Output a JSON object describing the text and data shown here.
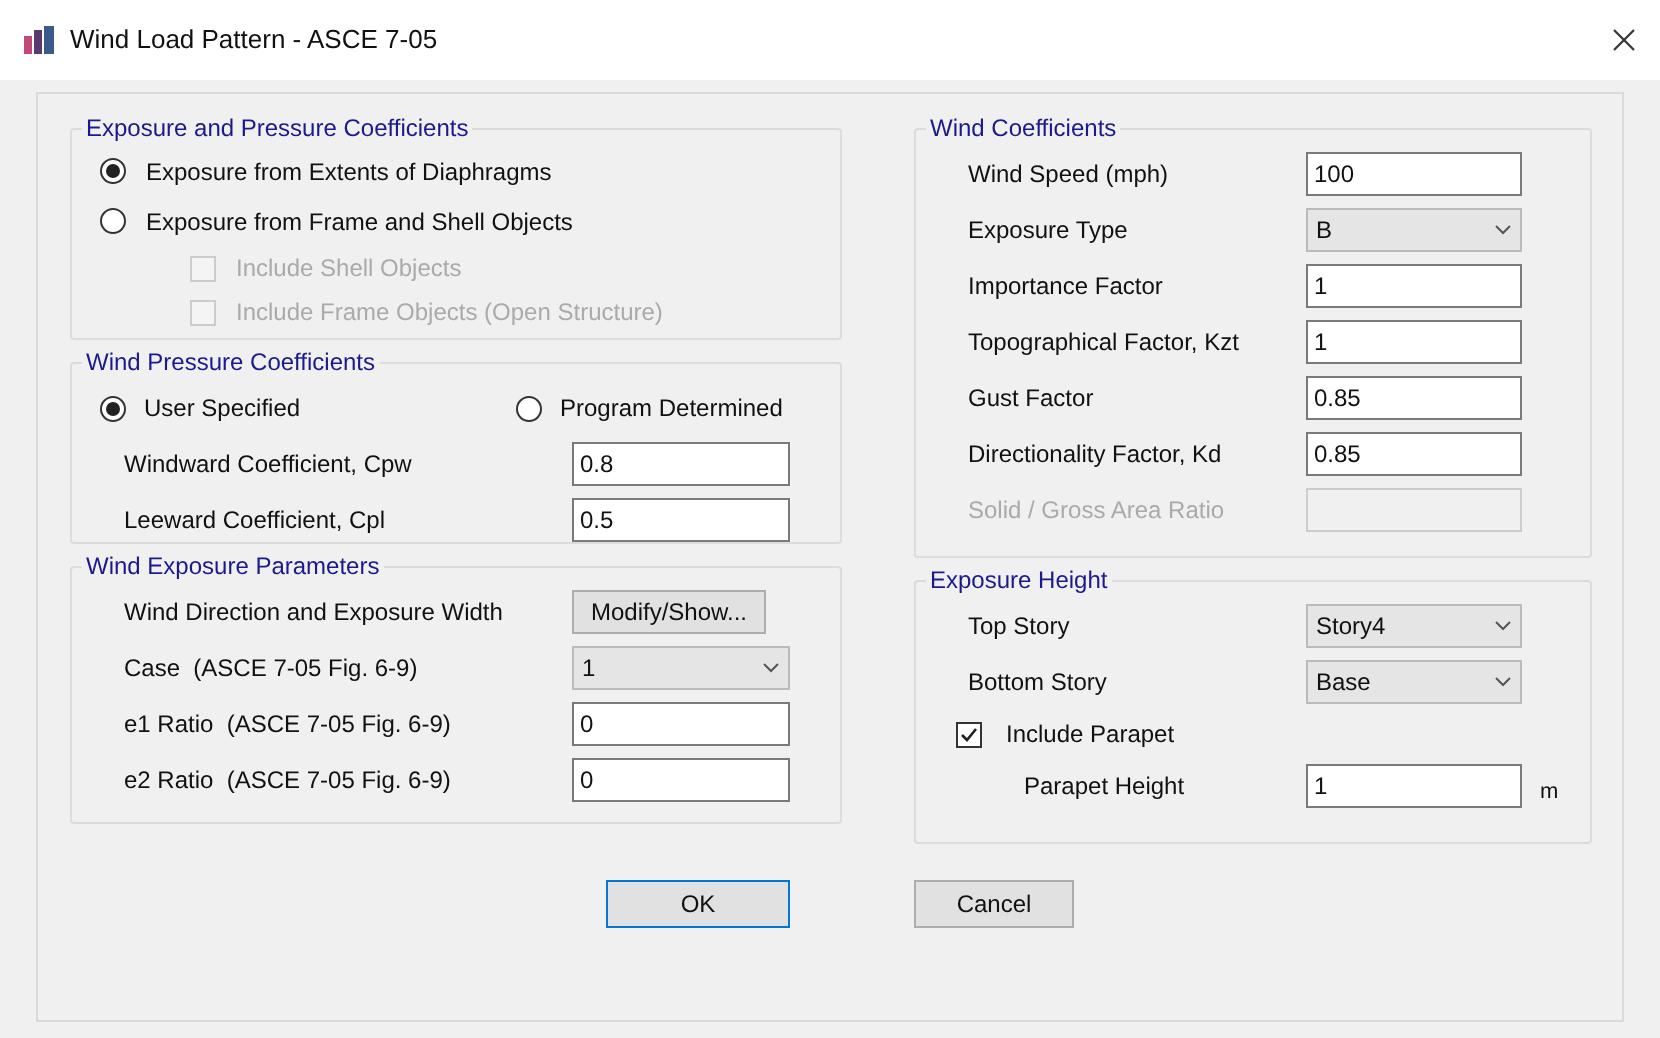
{
  "window": {
    "title": "Wind Load Pattern - ASCE 7-05"
  },
  "left_groups": [
    {
      "title": "Exposure and Pressure Coefficients",
      "rows": [
        {
          "kind": "radio",
          "label": "Exposure from Extents of Diaphragms",
          "selected": true,
          "children": []
        },
        {
          "kind": "radio",
          "label": "Exposure from Frame and Shell Objects",
          "selected": false,
          "children": [
            {
              "label": "Include Shell Objects",
              "checked": false,
              "disabled": true
            },
            {
              "label": "Include Frame Objects (Open Structure)",
              "checked": false,
              "disabled": true
            }
          ]
        }
      ]
    },
    {
      "title": "Wind Pressure Coefficients",
      "rows": [
        {
          "kind": "radio_pair",
          "options": [
            {
              "label": "User Specified",
              "selected": true
            },
            {
              "label": "Program Determined",
              "selected": false
            }
          ]
        },
        {
          "kind": "field",
          "label": "Windward Coefficient, Cpw",
          "value": "0.8",
          "disabled": false
        },
        {
          "kind": "field",
          "label": "Leeward Coefficient, Cpl",
          "value": "0.5",
          "disabled": false
        }
      ]
    },
    {
      "title": "Wind Exposure Parameters",
      "rows": [
        {
          "kind": "button",
          "label": "Wind Direction and Exposure Width",
          "button": "Modify/Show..."
        },
        {
          "kind": "dropdown",
          "label": "Case  (ASCE 7-05 Fig. 6-9)",
          "value": "1"
        },
        {
          "kind": "field",
          "label": "e1 Ratio  (ASCE 7-05 Fig. 6-9)",
          "value": "0",
          "disabled": false
        },
        {
          "kind": "field",
          "label": "e2 Ratio  (ASCE 7-05 Fig. 6-9)",
          "value": "0",
          "disabled": false
        }
      ]
    }
  ],
  "right_groups": [
    {
      "title": "Wind Coefficients",
      "rows": [
        {
          "kind": "field",
          "label": "Wind Speed (mph)",
          "value": "100",
          "disabled": false
        },
        {
          "kind": "dropdown",
          "label": "Exposure Type",
          "value": "B"
        },
        {
          "kind": "field",
          "label": "Importance Factor",
          "value": "1",
          "disabled": false
        },
        {
          "kind": "field",
          "label": "Topographical Factor, Kzt",
          "value": "1",
          "disabled": false
        },
        {
          "kind": "field",
          "label": "Gust Factor",
          "value": "0.85",
          "disabled": false
        },
        {
          "kind": "field",
          "label": "Directionality Factor, Kd",
          "value": "0.85",
          "disabled": false
        },
        {
          "kind": "field",
          "label": "Solid / Gross Area Ratio",
          "value": "",
          "disabled": true
        }
      ]
    },
    {
      "title": "Exposure Height",
      "rows": [
        {
          "kind": "dropdown",
          "label": "Top Story",
          "value": "Story4"
        },
        {
          "kind": "dropdown",
          "label": "Bottom Story",
          "value": "Base"
        },
        {
          "kind": "checkbox",
          "label": "Include Parapet",
          "checked": true,
          "disabled": false
        },
        {
          "kind": "field",
          "label": "Parapet Height",
          "value": "1",
          "disabled": false,
          "unit": "m",
          "indent": true
        }
      ]
    }
  ],
  "buttons": [
    "OK",
    "Cancel"
  ]
}
